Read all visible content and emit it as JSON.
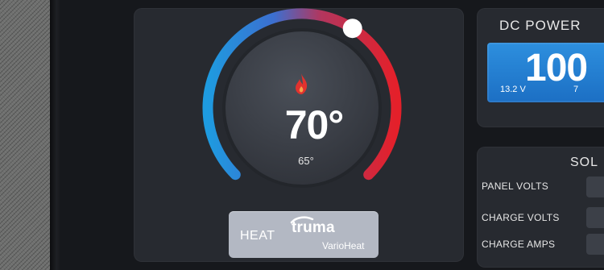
{
  "thermostat": {
    "set_temp": "70°",
    "current_temp": "65°",
    "mode_label": "HEAT",
    "brand": "truma",
    "model": "VarioHeat",
    "setpoint_fraction": 0.62,
    "colors": {
      "cold": "#1e9be0",
      "hot": "#e4202a",
      "knob": "#ffffff"
    }
  },
  "dc_power": {
    "title": "DC POWER",
    "value": "100",
    "volts": "13.2 V",
    "amps": "7"
  },
  "solar": {
    "title": "SOL",
    "rows": [
      {
        "label": "PANEL VOLTS"
      },
      {
        "label": "CHARGE VOLTS"
      },
      {
        "label": "CHARGE AMPS"
      }
    ]
  }
}
